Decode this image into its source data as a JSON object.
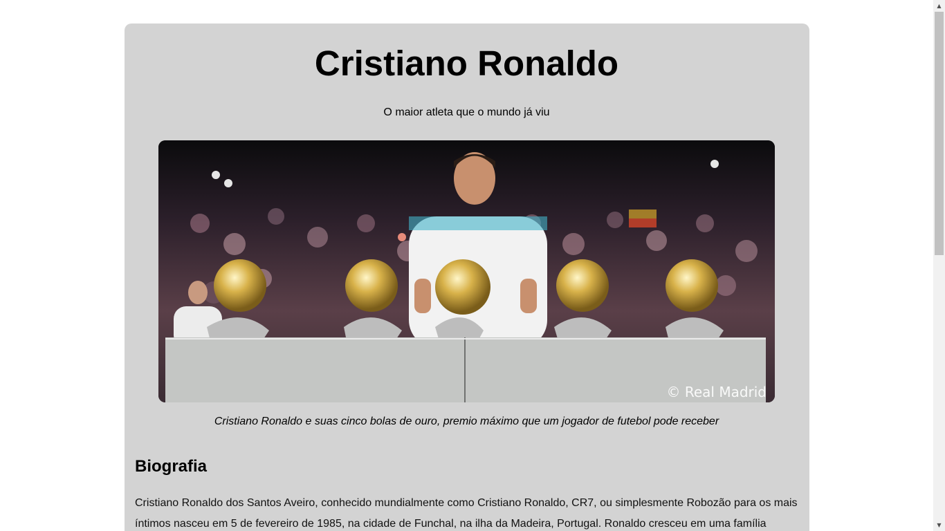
{
  "page": {
    "title": "Cristiano Ronaldo",
    "subtitle": "O maior atleta que o mundo já viu"
  },
  "hero_image": {
    "watermark": "© Real Madrid",
    "caption": "Cristiano Ronaldo e suas cinco bolas de ouro, premio máximo que um jogador de futebol pode receber"
  },
  "biography": {
    "heading": "Biografia",
    "text": "Cristiano Ronaldo dos Santos Aveiro, conhecido mundialmente como Cristiano Ronaldo, CR7, ou simplesmente Robozão para os mais íntimos nasceu em 5 de fevereiro de 1985, na cidade de Funchal, na ilha da Madeira, Portugal. Ronaldo cresceu em uma família"
  },
  "scrollbar": {
    "up_icon": "chevron-up-icon",
    "down_icon": "chevron-down-icon"
  }
}
